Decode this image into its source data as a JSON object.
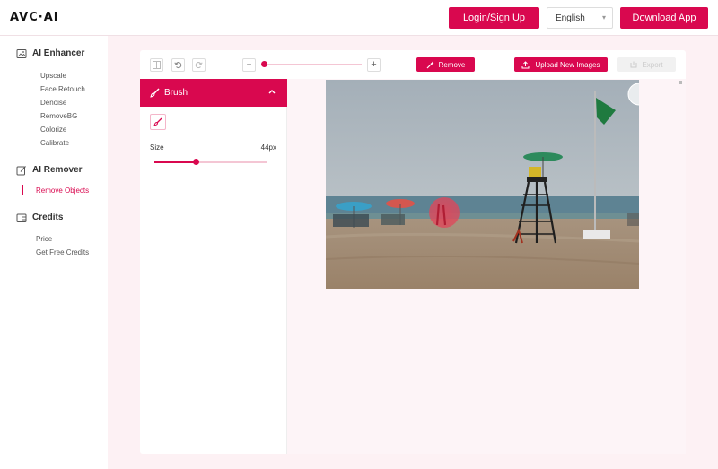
{
  "header": {
    "logo": "AVC·AI",
    "login_label": "Login/Sign Up",
    "language": "English",
    "download_label": "Download App"
  },
  "sidebar": {
    "groups": [
      {
        "title": "AI Enhancer",
        "icon": "image-icon",
        "items": [
          "Upscale",
          "Face Retouch",
          "Denoise",
          "RemoveBG",
          "Colorize",
          "Calibrate"
        ]
      },
      {
        "title": "AI Remover",
        "icon": "edit-icon",
        "items": [
          "Remove Objects"
        ]
      },
      {
        "title": "Credits",
        "icon": "wallet-icon",
        "items": [
          "Price",
          "Get Free Credits"
        ]
      }
    ],
    "active_item": "Remove Objects"
  },
  "toolbar": {
    "zoom_level": 0.02,
    "remove_label": "Remove",
    "upload_label": "Upload New Images",
    "export_label": "Export"
  },
  "brush": {
    "title": "Brush",
    "size_label": "Size",
    "size_value": "44px",
    "size_fraction": 0.37
  },
  "colors": {
    "accent": "#d9084f",
    "accent_light": "#f4c6d4",
    "background": "#fdf1f4"
  }
}
